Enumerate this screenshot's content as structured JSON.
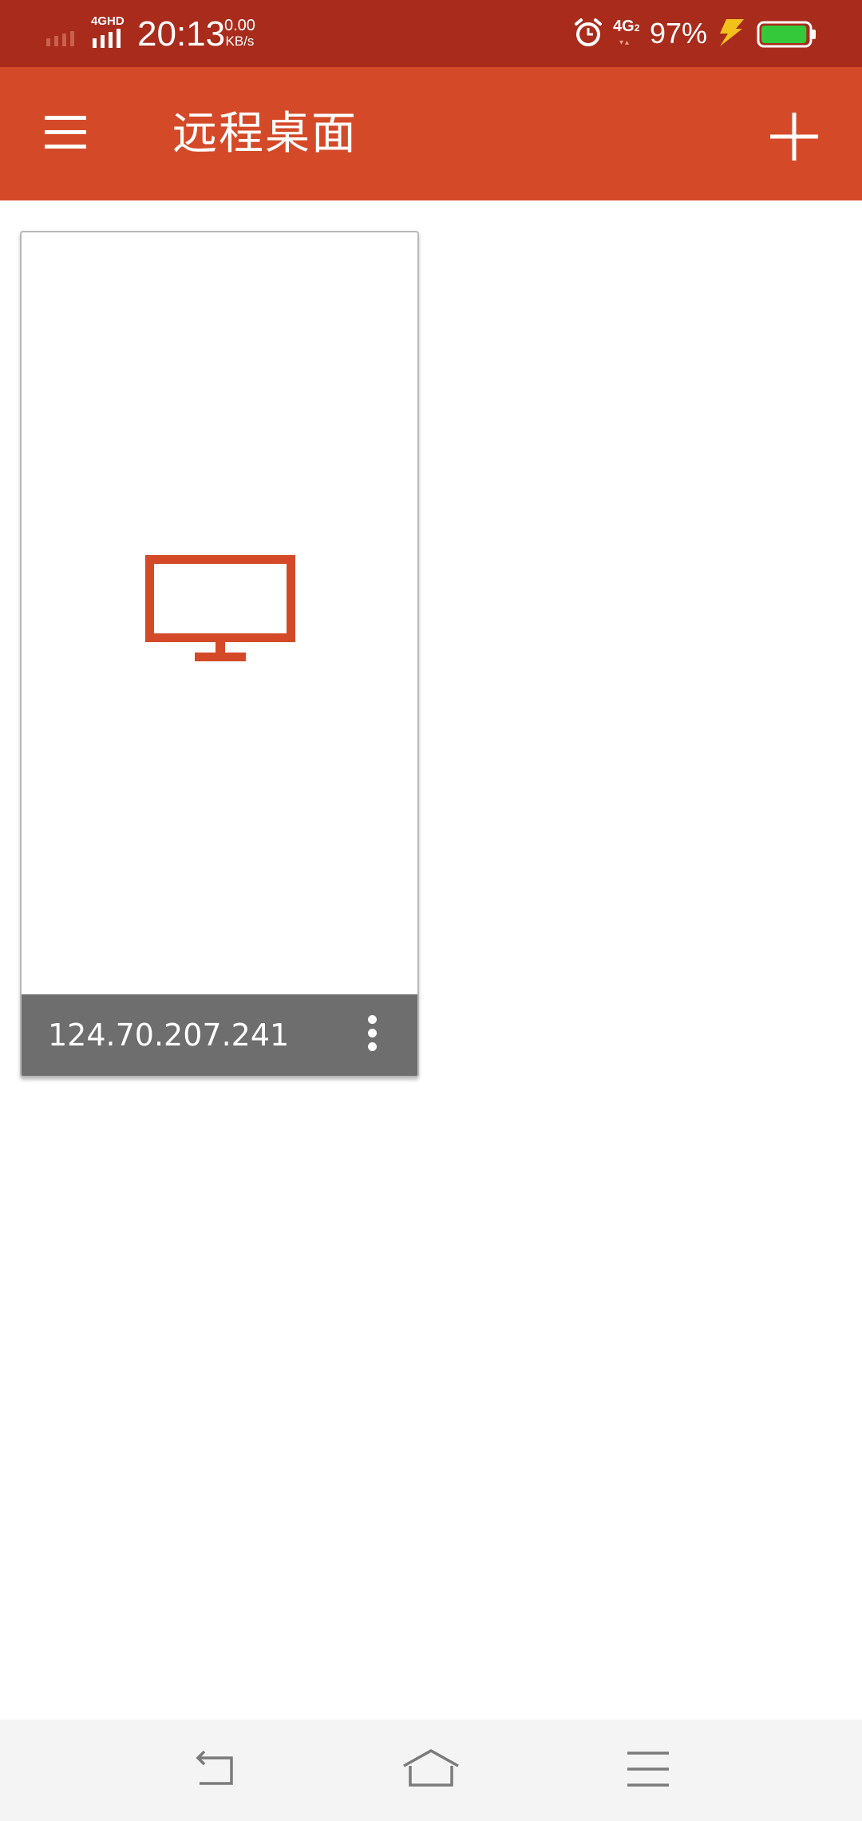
{
  "status_bar": {
    "network_label": "4GHD",
    "time": "20:13",
    "speed_value": "0.00",
    "speed_unit": "KB/s",
    "secondary_network": "4G",
    "secondary_network_sub": "2",
    "battery_percent": "97%",
    "battery_level": 0.97
  },
  "app_bar": {
    "title": "远程桌面",
    "menu_icon": "hamburger-menu-icon",
    "add_icon": "plus-icon"
  },
  "desktops": [
    {
      "host": "124.70.207.241",
      "thumbnail_icon": "monitor-icon",
      "more_icon": "more-vert-icon"
    }
  ],
  "colors": {
    "status_bar_bg": "#a92b1b",
    "app_bar_bg": "#d44a28",
    "accent": "#d44a28",
    "card_footer_bg": "#6e6e6e",
    "nav_bar_bg": "#f4f4f4"
  },
  "nav_bar": {
    "back_icon": "back-icon",
    "home_icon": "home-icon",
    "recents_icon": "recents-menu-icon"
  }
}
